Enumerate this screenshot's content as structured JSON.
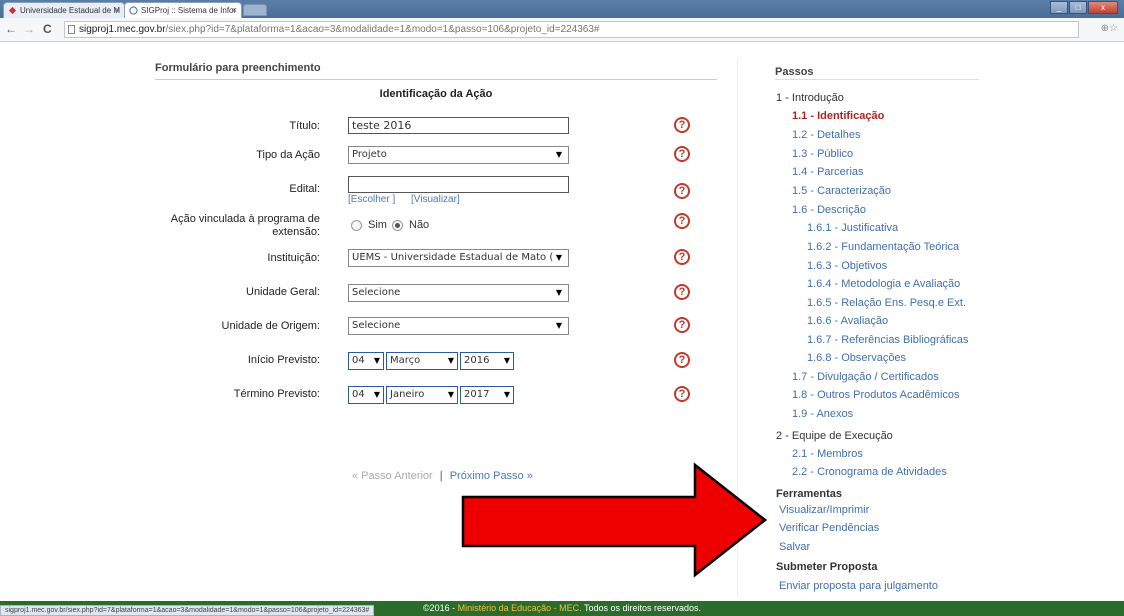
{
  "browser": {
    "tabs": [
      {
        "title": "Universidade Estadual de M"
      },
      {
        "title": "SIGProj :: Sistema de Infor"
      }
    ],
    "url_host": "sigproj1.mec.gov.br",
    "url_rest": "/siex.php?id=7&plataforma=1&acao=3&modalidade=1&modo=1&passo=106&projeto_id=224363#",
    "status_url": "sigproj1.mec.gov.br/siex.php?id=7&plataforma=1&acao=3&modalidade=1&modo=1&passo=106&projeto_id=224363#"
  },
  "form": {
    "header": "Formulário para preenchimento",
    "subtitle": "Identificação da Ação",
    "titulo": {
      "label": "Título:",
      "value": "teste 2016"
    },
    "tipo": {
      "label": "Tipo da Ação",
      "value": "Projeto"
    },
    "edital": {
      "label": "Edital:",
      "value": "",
      "choose": "[Escolher ]",
      "view": "[Visualizar]"
    },
    "vinculada": {
      "label_line1": "Ação vinculada à programa de",
      "label_line2": "extensão:",
      "opt_sim": "Sim",
      "opt_nao": "Não",
      "selected": "Não"
    },
    "instituicao": {
      "label": "Instituição:",
      "value": "UEMS - Universidade Estadual de Mato ("
    },
    "unidade_geral": {
      "label": "Unidade Geral:",
      "value": "Selecione"
    },
    "unidade_origem": {
      "label": "Unidade de Origem:",
      "value": "Selecione"
    },
    "inicio": {
      "label": "Início Previsto:",
      "day": "04",
      "month": "Março",
      "year": "2016"
    },
    "termino": {
      "label": "Término Previsto:",
      "day": "04",
      "month": "Janeiro",
      "year": "2017"
    },
    "help_glyph": "?",
    "pager": {
      "prev": "« Passo Anterior",
      "sep": "|",
      "next": "Próximo Passo »"
    }
  },
  "sidebar": {
    "title": "Passos",
    "items": [
      {
        "label": "1 - Introdução",
        "kind": "section"
      },
      {
        "label": "1.1 - Identificação",
        "kind": "active"
      },
      {
        "label": "1.2 - Detalhes",
        "kind": "link"
      },
      {
        "label": "1.3 - Público",
        "kind": "link"
      },
      {
        "label": "1.4 - Parcerias",
        "kind": "link"
      },
      {
        "label": "1.5 - Caracterização",
        "kind": "link"
      },
      {
        "label": "1.6 - Descrição",
        "kind": "link"
      },
      {
        "label": "1.6.1 - Justificativa",
        "kind": "link"
      },
      {
        "label": "1.6.2 - Fundamentação Teórica",
        "kind": "link"
      },
      {
        "label": "1.6.3 - Objetivos",
        "kind": "link"
      },
      {
        "label": "1.6.4 - Metodologia e Avaliação",
        "kind": "link"
      },
      {
        "label": "1.6.5 - Relação Ens. Pesq.e Ext.",
        "kind": "link"
      },
      {
        "label": "1.6.6 - Avaliação",
        "kind": "link"
      },
      {
        "label": "1.6.7 - Referências Bibliográficas",
        "kind": "link"
      },
      {
        "label": "1.6.8 - Observações",
        "kind": "link"
      },
      {
        "label": "1.7 - Divulgação / Certificados",
        "kind": "link"
      },
      {
        "label": "1.8 - Outros Produtos Acadêmicos",
        "kind": "link"
      },
      {
        "label": "1.9 - Anexos",
        "kind": "link"
      },
      {
        "label": "2 - Equipe de Execução",
        "kind": "section"
      },
      {
        "label": "2.1 - Membros",
        "kind": "link"
      },
      {
        "label": "2.2 - Cronograma de Atividades",
        "kind": "link"
      }
    ],
    "tools_title": "Ferramentas",
    "tools": [
      "Visualizar/Imprimir",
      "Verificar Pendências",
      "Salvar"
    ],
    "submit_title": "Submeter Proposta",
    "submit_link": "Enviar proposta para julgamento"
  },
  "footer": {
    "prefix": "©2016 - ",
    "mec": "Ministério da Educação - MEC.",
    "suffix": " Todos os direitos reservados."
  },
  "colors": {
    "active_step": "#b22222",
    "link": "#3f6fb0",
    "footer_bg": "#2b6b2b",
    "arrow": "#ee0000"
  }
}
